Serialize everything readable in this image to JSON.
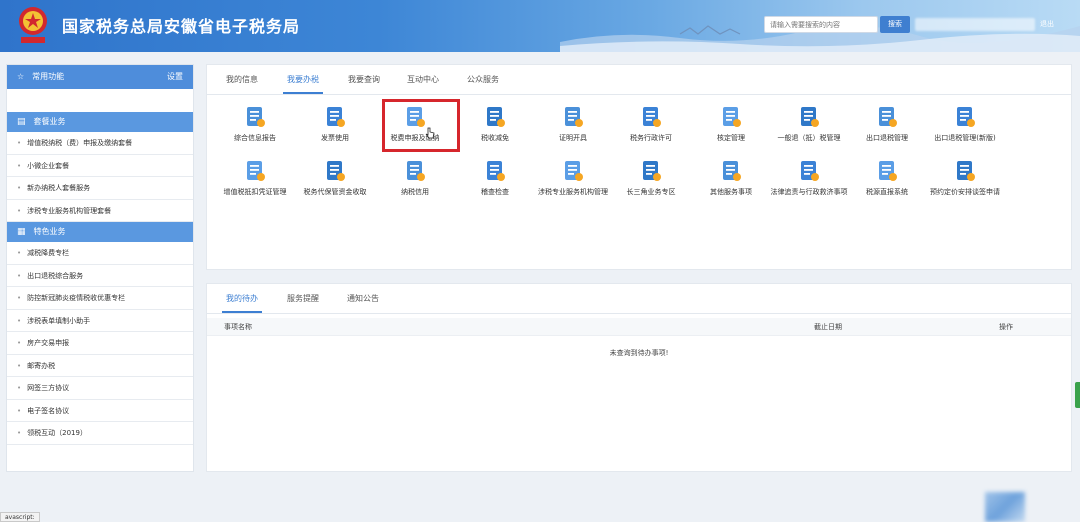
{
  "header": {
    "title": "国家税务总局安徽省电子税务局",
    "search_placeholder": "请输入需要搜索的内容",
    "search_button": "搜索",
    "logout": "退出",
    "brand_color": "#2f74cb"
  },
  "sidebar": {
    "favorites_label": "常用功能",
    "settings_label": "设置",
    "section1": "套餐业务",
    "section1_items": [
      "增值税纳税（费）申报及缴纳套餐",
      "小微企业套餐",
      "新办纳税人套餐服务",
      "涉税专业服务机构管理套餐"
    ],
    "section2": "特色业务",
    "section2_items": [
      "减税降费专栏",
      "出口退税综合服务",
      "防控新冠肺炎疫情税收优惠专栏",
      "涉税表单填制小助手",
      "房产交易申报",
      "邮寄办税",
      "网签三方协议",
      "电子签名协议",
      "领税互动（2019）"
    ]
  },
  "tabs": [
    "我的信息",
    "我要办税",
    "我要查询",
    "互动中心",
    "公众服务"
  ],
  "active_tab": 1,
  "functions": [
    {
      "label": "综合信息报告",
      "icon": "report-icon"
    },
    {
      "label": "发票使用",
      "icon": "invoice-icon"
    },
    {
      "label": "税费申报及缴纳",
      "icon": "tax-declare-icon"
    },
    {
      "label": "税收减免",
      "icon": "tax-relief-icon"
    },
    {
      "label": "证明开具",
      "icon": "certificate-icon"
    },
    {
      "label": "税务行政许可",
      "icon": "permit-chart-icon"
    },
    {
      "label": "核定管理",
      "icon": "assessment-icon"
    },
    {
      "label": "一般退（抵）税管理",
      "icon": "refund-icon"
    },
    {
      "label": "出口退税管理",
      "icon": "export-refund-icon"
    },
    {
      "label": "出口退税管理(新版)",
      "icon": "export-refund-new-icon"
    },
    {
      "label": "增值税抵扣凭证管理",
      "icon": "vat-voucher-icon"
    },
    {
      "label": "税务代保管资金收取",
      "icon": "custody-fund-icon"
    },
    {
      "label": "纳税信用",
      "icon": "credit-icon"
    },
    {
      "label": "稽查检查",
      "icon": "inspection-icon"
    },
    {
      "label": "涉税专业服务机构管理",
      "icon": "agency-icon"
    },
    {
      "label": "长三角业务专区",
      "icon": "yrd-icon"
    },
    {
      "label": "其他服务事项",
      "icon": "other-services-icon"
    },
    {
      "label": "法律追责与行政救济事项",
      "icon": "legal-icon"
    },
    {
      "label": "税源直报系统",
      "icon": "tax-source-icon"
    },
    {
      "label": "预约定价安排谈签申请",
      "icon": "pricing-icon"
    }
  ],
  "bottom": {
    "tabs": [
      "我的待办",
      "服务提醒",
      "通知公告"
    ],
    "active_tab": 0,
    "columns": [
      "事项名称",
      "截止日期",
      "操作"
    ],
    "empty_text": "未查询到待办事项!"
  },
  "status_bar": "avascript:"
}
